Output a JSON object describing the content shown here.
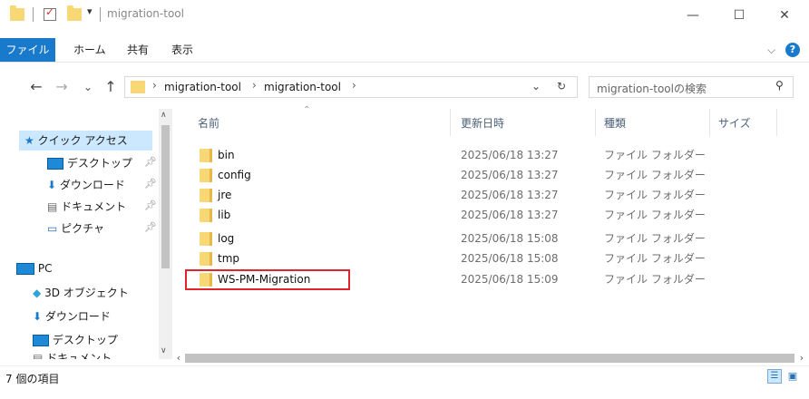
{
  "window": {
    "title": "migration-tool",
    "minimize": "—",
    "maximize": "☐",
    "close": "✕"
  },
  "ribbon": {
    "tabs": [
      "ファイル",
      "ホーム",
      "共有",
      "表示"
    ],
    "expand": "⌵",
    "help": "?"
  },
  "nav": {
    "back": "←",
    "forward": "→",
    "recent": "⌄",
    "up": "↑",
    "breadcrumb": [
      "migration-tool",
      "migration-tool"
    ],
    "dropdown": "⌄",
    "refresh": "↻",
    "search_placeholder": "migration-toolの検索",
    "search_icon": "⚲"
  },
  "navpane": {
    "quick_access": "クイック アクセス",
    "quick_items": [
      "デスクトップ",
      "ダウンロード",
      "ドキュメント",
      "ピクチャ"
    ],
    "pc": "PC",
    "pc_items": [
      "3D オブジェクト",
      "ダウンロード",
      "デスクトップ",
      "ドキュメント"
    ]
  },
  "columns": {
    "name": "名前",
    "date": "更新日時",
    "type": "種類",
    "size": "サイズ"
  },
  "files": [
    {
      "name": "bin",
      "date": "2025/06/18 13:27",
      "type": "ファイル フォルダー"
    },
    {
      "name": "config",
      "date": "2025/06/18 13:27",
      "type": "ファイル フォルダー"
    },
    {
      "name": "jre",
      "date": "2025/06/18 13:27",
      "type": "ファイル フォルダー"
    },
    {
      "name": "lib",
      "date": "2025/06/18 13:27",
      "type": "ファイル フォルダー"
    },
    {
      "name": "log",
      "date": "2025/06/18 15:08",
      "type": "ファイル フォルダー"
    },
    {
      "name": "tmp",
      "date": "2025/06/18 15:08",
      "type": "ファイル フォルダー"
    },
    {
      "name": "WS-PM-Migration",
      "date": "2025/06/18 15:09",
      "type": "ファイル フォルダー"
    }
  ],
  "status": {
    "count": "7 個の項目"
  },
  "colors": {
    "file_tab": "#1979ca",
    "folder": "#f8d775",
    "highlight": "#e0262a"
  }
}
